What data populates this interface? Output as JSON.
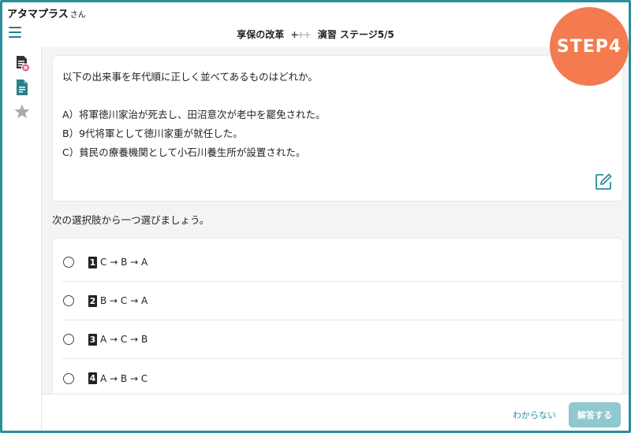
{
  "header": {
    "username": "アタマプラス",
    "honorific": "さん",
    "title_topic": "享保の改革",
    "title_mode": "演習 ステージ5/5",
    "plus_icons": "+++"
  },
  "step_badge": "STEP4",
  "sidebar": {
    "items": [
      {
        "icon": "document-error-icon"
      },
      {
        "icon": "document-icon"
      },
      {
        "icon": "star-icon"
      }
    ]
  },
  "question": {
    "prompt": "以下の出来事を年代順に正しく並べてあるものはどれか。",
    "events": [
      "A）将軍徳川家治が死去し、田沼意次が老中を罷免された。",
      "B）9代将軍として徳川家重が就任した。",
      "C）貧民の療養機関として小石川養生所が設置された。"
    ]
  },
  "instruction": "次の選択肢から一つ選びましょう。",
  "choices": [
    {
      "num": "1",
      "text": "C → B → A"
    },
    {
      "num": "2",
      "text": "B → C → A"
    },
    {
      "num": "3",
      "text": "A → C → B"
    },
    {
      "num": "4",
      "text": "A → B → C"
    }
  ],
  "footer": {
    "dont_know": "わからない",
    "submit": "解答する"
  },
  "colors": {
    "accent": "#2a8f9a",
    "step_badge": "#f47b4f",
    "submit_disabled": "#8fc8cf",
    "error_badge": "#e35d7a"
  }
}
